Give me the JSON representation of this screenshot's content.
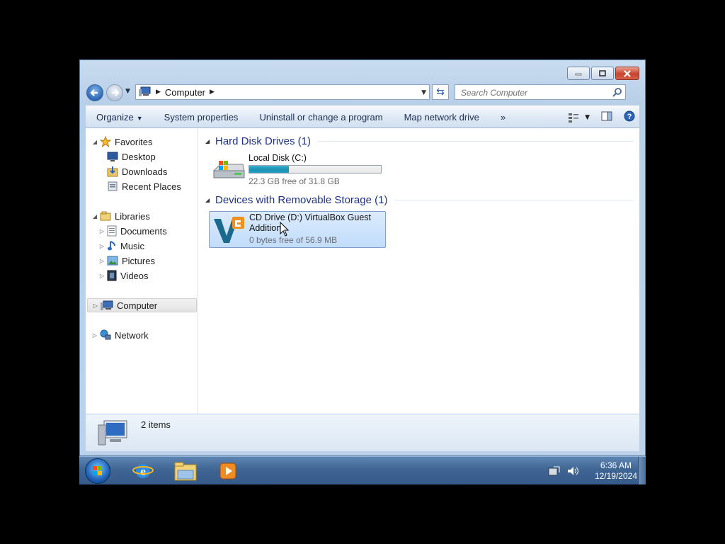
{
  "window": {
    "caption_buttons": [
      "minimize-icon",
      "maximize-icon",
      "close-icon"
    ]
  },
  "address_bar": {
    "crumb": "Computer",
    "search_placeholder": "Search Computer"
  },
  "toolbar": {
    "organize": "Organize",
    "system_properties": "System properties",
    "uninstall": "Uninstall or change a program",
    "map_drive": "Map network drive",
    "more": "»"
  },
  "nav": {
    "favorites": "Favorites",
    "desktop": "Desktop",
    "downloads": "Downloads",
    "recent": "Recent Places",
    "libraries": "Libraries",
    "documents": "Documents",
    "music": "Music",
    "pictures": "Pictures",
    "videos": "Videos",
    "computer": "Computer",
    "network": "Network"
  },
  "groups": {
    "hdd_title": "Hard Disk Drives (1)",
    "removable_title": "Devices with Removable Storage (1)"
  },
  "drives": {
    "c": {
      "name": "Local Disk (C:)",
      "free": "22.3 GB free of 31.8 GB",
      "used_fraction": 0.3
    },
    "d": {
      "name": "CD Drive (D:) VirtualBox Guest Additions",
      "free": "0 bytes free of 56.9 MB"
    }
  },
  "details": {
    "count": "2 items"
  },
  "taskbar": {
    "time": "6:36 AM",
    "date": "12/19/2024"
  },
  "colors": {
    "accent": "#1e3287",
    "selection": "#c1dcfc",
    "taskbar": "#3f6593"
  }
}
